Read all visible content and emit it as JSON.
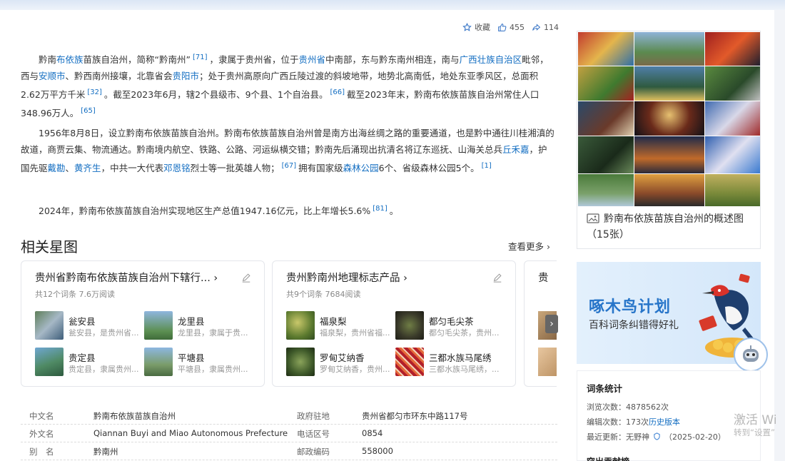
{
  "actions": {
    "favorite_label": "收藏",
    "like_count": "455",
    "share_count": "114"
  },
  "paragraphs": {
    "p1": {
      "t1": "黔南",
      "l1": "布依族",
      "t2": "苗族自治州，简称“黔南州”",
      "r1": "[71]",
      "t3": "，隶属于贵州省，位于",
      "l2": "贵州省",
      "t4": "中南部，东与黔东南州相连，南与",
      "l3": "广西壮族自治区",
      "t5": "毗邻，西与",
      "l4": "安顺市",
      "t6": "、黔西南州接壤，北靠省会",
      "l5": "贵阳市",
      "t7": "；处于贵州高原向广西丘陵过渡的斜坡地带，地势北高南低，地处东亚季风区，总面积2.62万平方千米",
      "r2": "[32]",
      "t8": "。截至2023年6月，辖2个县级市、9个县、1个自治县。",
      "r3": "[66]",
      "t9": "截至2023年末，黔南布依族苗族自治州常住人口348.96万人。",
      "r4": "[65]"
    },
    "p2": {
      "t1": "1956年8月8日，设立黔南布依族苗族自治州。黔南布依族苗族自治州曾是南方出海丝绸之路的重要通道，也是黔中通往川桂湘滇的故道，商贾云集、物流通达。黔南境内航空、铁路、公路、河运纵横交错；黔南先后涌现出抗清名将辽东巡抚、山海关总兵",
      "l1": "丘禾嘉",
      "t2": "，护国先驱",
      "l2": "戴勘",
      "t3": "、",
      "l3": "黄齐生",
      "t4": "，中共一大代表",
      "l4": "邓恩铭",
      "t5": "烈士等一批英雄人物；",
      "r1": "[67]",
      "t6": "拥有国家级",
      "l5": "森林公园",
      "t7": "6个、省级森林公园5个。",
      "r2": "[1]"
    },
    "p3": {
      "t1": "2024年，黔南布依族苗族自治州实现地区生产总值1947.16亿元，比上年增长5.6%",
      "r1": "[81]",
      "t2": "。"
    }
  },
  "related": {
    "title": "相关星图",
    "see_more": "查看更多 ›",
    "cards": [
      {
        "title": "贵州省黔南布依族苗族自治州下辖行... ›",
        "meta": "共12个词条    7.6万阅读",
        "items": [
          {
            "name": "瓮安县",
            "desc": "瓮安县，是贵州省..."
          },
          {
            "name": "龙里县",
            "desc": "龙里县，隶属于贵..."
          },
          {
            "name": "贵定县",
            "desc": "贵定县，隶属贵州..."
          },
          {
            "name": "平塘县",
            "desc": "平塘县，隶属贵州..."
          }
        ]
      },
      {
        "title": "贵州黔南州地理标志产品 ›",
        "meta": "共9个词条    7684阅读",
        "items": [
          {
            "name": "福泉梨",
            "desc": "福泉梨，贵州省福..."
          },
          {
            "name": "都匀毛尖茶",
            "desc": "都匀毛尖茶，贵州..."
          },
          {
            "name": "罗甸艾纳香",
            "desc": "罗甸艾纳香，贵州..."
          },
          {
            "name": "三都水族马尾绣",
            "desc": "三都水族马尾绣，..."
          }
        ]
      }
    ],
    "partial_title": "贵"
  },
  "info": [
    {
      "k1": "中文名",
      "v1": "黔南布依族苗族自治州",
      "k2": "政府驻地",
      "v2": "贵州省都匀市环东中路117号"
    },
    {
      "k1": "外文名",
      "v1": "Qiannan Buyi and Miao Autonomous Prefecture",
      "k2": "电话区号",
      "v2": "0854"
    },
    {
      "k1": "别　名",
      "v1": "黔南州",
      "k2": "邮政编码",
      "v2": "558000"
    }
  ],
  "album": {
    "caption": "黔南布依族苗族自治州的概述图（15张）"
  },
  "promo": {
    "title": "啄木鸟计划",
    "subtitle": "百科词条纠错得好礼"
  },
  "stats": {
    "title": "词条统计",
    "views": "浏览次数：4878562次",
    "edits": "编辑次数：173次",
    "history": "历史版本",
    "updated_label": "最近更新：无野神",
    "updated_date": "（2025-02-20）",
    "next_heading": "突出贡献榜"
  },
  "watermark": {
    "line1": "激活 Wi",
    "line2": "转到“设置”"
  }
}
